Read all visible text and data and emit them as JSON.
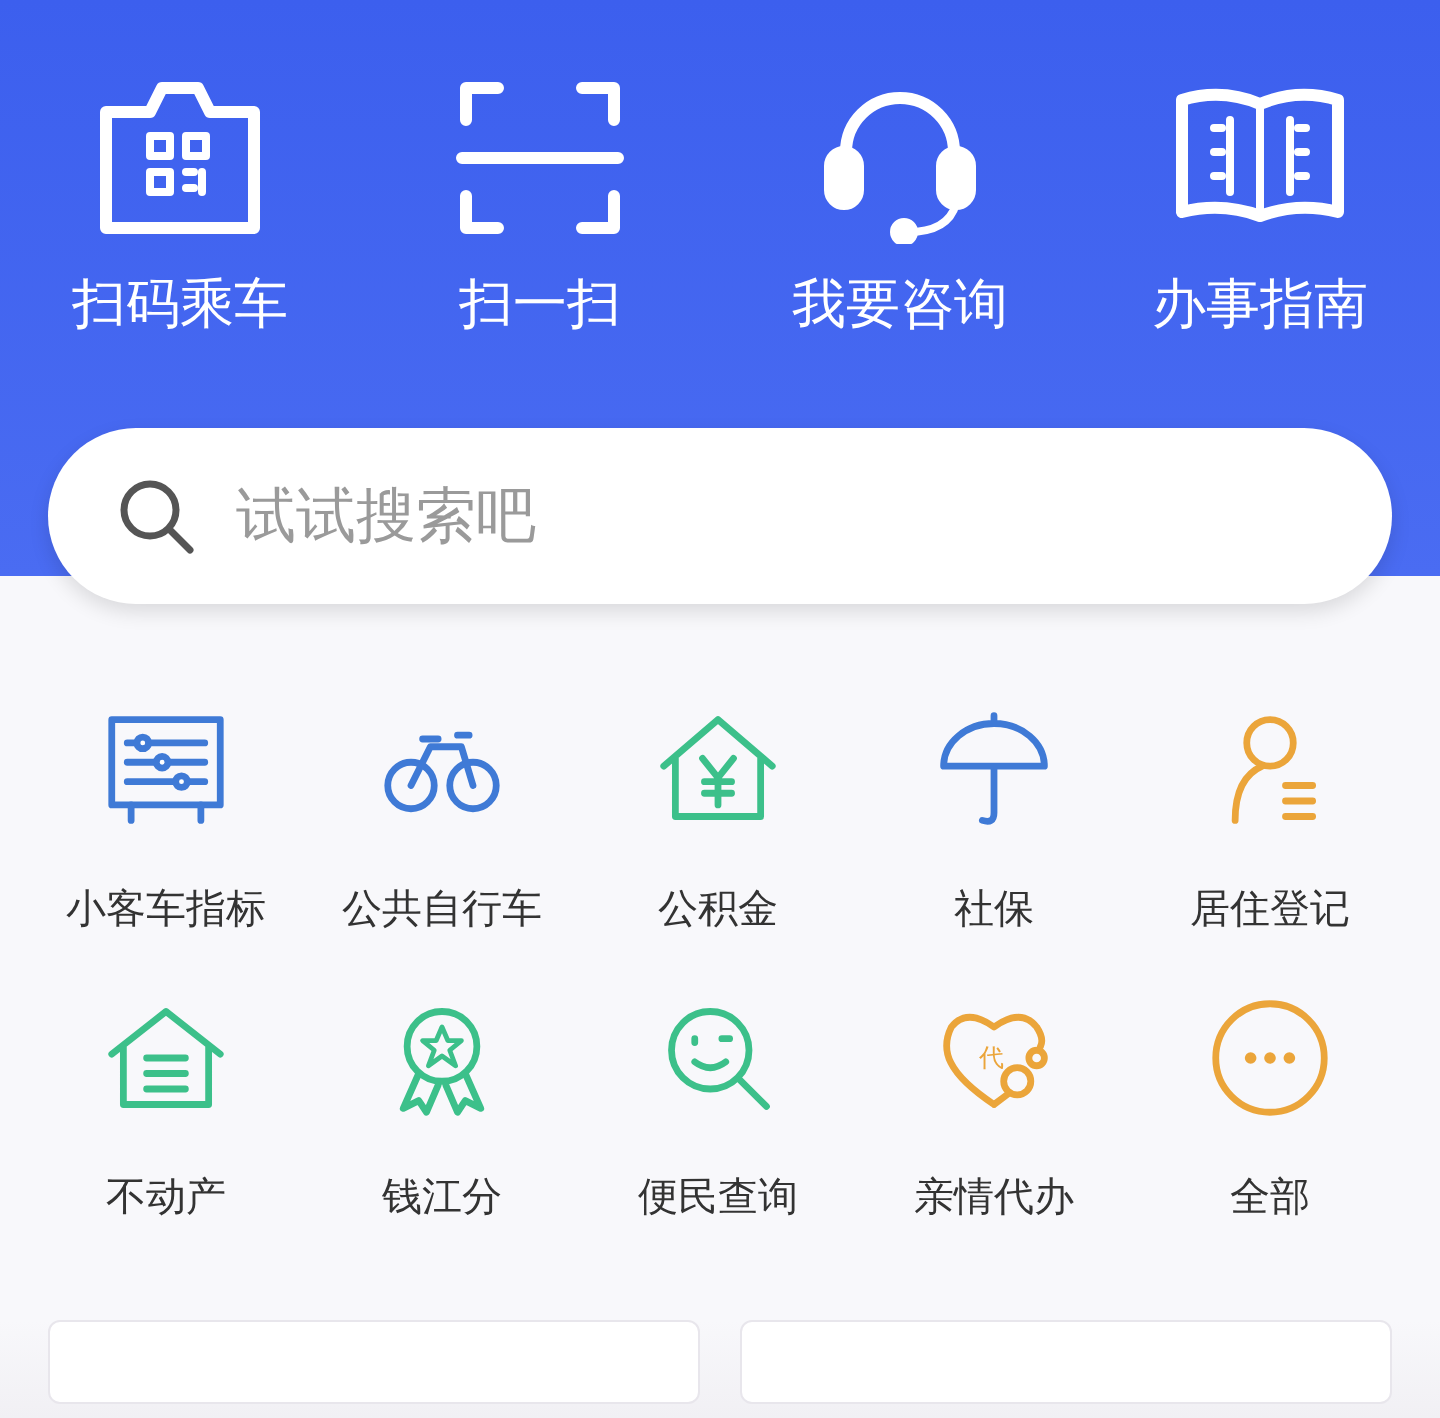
{
  "quick_actions": [
    {
      "label": "扫码乘车"
    },
    {
      "label": "扫一扫"
    },
    {
      "label": "我要咨询"
    },
    {
      "label": "办事指南"
    }
  ],
  "search": {
    "placeholder": "试试搜索吧"
  },
  "services": [
    {
      "label": "小客车指标",
      "color": "#3f7ad6"
    },
    {
      "label": "公共自行车",
      "color": "#3f7ad6"
    },
    {
      "label": "公积金",
      "color": "#3cc08a"
    },
    {
      "label": "社保",
      "color": "#3f7ad6"
    },
    {
      "label": "居住登记",
      "color": "#eba53a"
    },
    {
      "label": "不动产",
      "color": "#3cc08a"
    },
    {
      "label": "钱江分",
      "color": "#3cc08a"
    },
    {
      "label": "便民查询",
      "color": "#3cc08a"
    },
    {
      "label": "亲情代办",
      "color": "#eba53a",
      "badge": "代"
    },
    {
      "label": "全部",
      "color": "#eba53a"
    }
  ]
}
